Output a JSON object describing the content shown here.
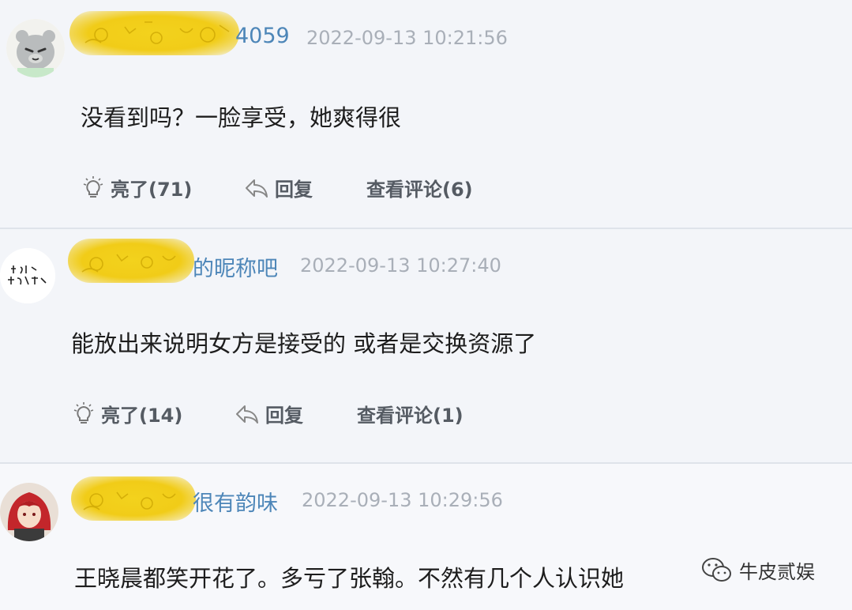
{
  "comments": [
    {
      "username_visible": "4059",
      "timestamp": "2022-09-13 10:21:56",
      "text": "没看到吗？一脸享受，她爽得很",
      "like_label": "亮了(71)",
      "reply_label": "回复",
      "view_label": "查看评论(6)",
      "avatar": "gray-cat-avatar"
    },
    {
      "username_visible": "的昵称吧",
      "timestamp": "2022-09-13 10:27:40",
      "text": "能放出来说明女方是接受的 或者是交换资源了",
      "like_label": "亮了(14)",
      "reply_label": "回复",
      "view_label": "查看评论(1)",
      "avatar": "calligraphy-avatar"
    },
    {
      "username_visible": "很有韵味",
      "timestamp": "2022-09-13 10:29:56",
      "text": "王晓晨都笑开花了。多亏了张翰。不然有几个人认识她",
      "avatar": "red-hair-character-avatar"
    }
  ],
  "watermark": {
    "text": "牛皮贰娱",
    "icon": "wechat-icon"
  },
  "colors": {
    "username": "#4d86b8",
    "timestamp": "#a9afb8",
    "highlight": "#f1cc18",
    "background": "#f3f5f9"
  }
}
